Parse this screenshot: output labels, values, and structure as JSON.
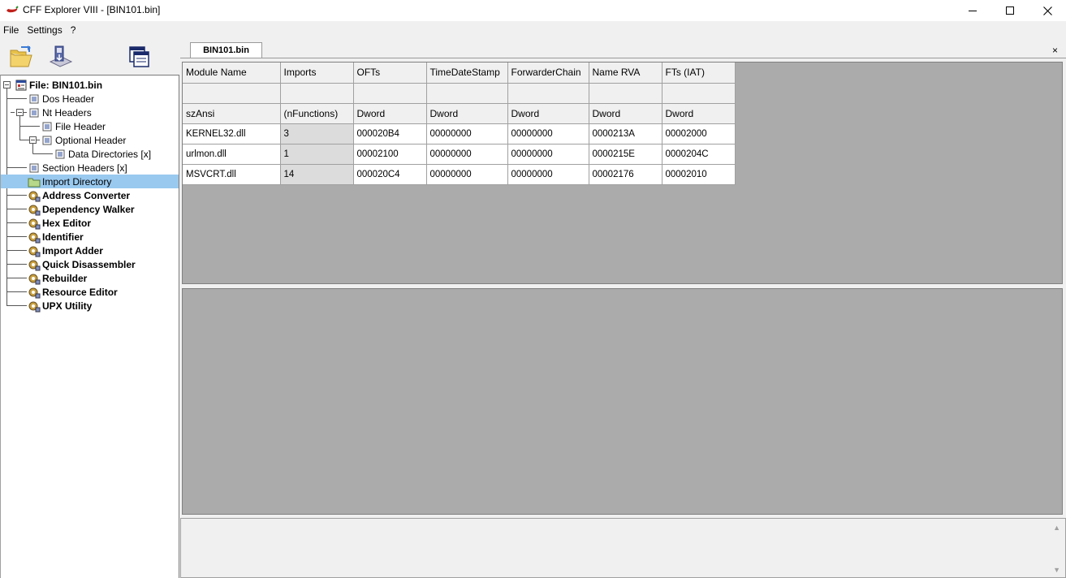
{
  "window": {
    "title": "CFF Explorer VIII - [BIN101.bin]"
  },
  "menu": {
    "items": [
      "File",
      "Settings",
      "?"
    ]
  },
  "toolbar": {
    "icons": [
      "open-file-icon",
      "save-disk-icon",
      "windows-icon"
    ]
  },
  "tree": {
    "items": [
      {
        "label": "File: BIN101.bin",
        "icon": "file-icon",
        "bold": true
      },
      {
        "label": "Dos Header",
        "icon": "list-icon"
      },
      {
        "label": "Nt Headers",
        "icon": "list-icon"
      },
      {
        "label": "File Header",
        "icon": "list-icon"
      },
      {
        "label": "Optional Header",
        "icon": "list-icon"
      },
      {
        "label": "Data Directories [x]",
        "icon": "list-icon"
      },
      {
        "label": "Section Headers [x]",
        "icon": "list-icon"
      },
      {
        "label": "Import Directory",
        "icon": "folder-icon",
        "selected": true
      },
      {
        "label": "Address Converter",
        "icon": "tool-icon",
        "bold": true
      },
      {
        "label": "Dependency Walker",
        "icon": "tool-icon",
        "bold": true
      },
      {
        "label": "Hex Editor",
        "icon": "tool-icon",
        "bold": true
      },
      {
        "label": "Identifier",
        "icon": "tool-icon",
        "bold": true
      },
      {
        "label": "Import Adder",
        "icon": "tool-icon",
        "bold": true
      },
      {
        "label": "Quick Disassembler",
        "icon": "tool-icon",
        "bold": true
      },
      {
        "label": "Rebuilder",
        "icon": "tool-icon",
        "bold": true
      },
      {
        "label": "Resource Editor",
        "icon": "tool-icon",
        "bold": true
      },
      {
        "label": "UPX Utility",
        "icon": "tool-icon",
        "bold": true
      }
    ]
  },
  "tab": {
    "label": "BIN101.bin",
    "close": "×"
  },
  "grid": {
    "columns": [
      "Module Name",
      "Imports",
      "OFTs",
      "TimeDateStamp",
      "ForwarderChain",
      "Name RVA",
      "FTs (IAT)"
    ],
    "types": [
      "szAnsi",
      "(nFunctions)",
      "Dword",
      "Dword",
      "Dword",
      "Dword",
      "Dword"
    ],
    "rows": [
      [
        "KERNEL32.dll",
        "3",
        "000020B4",
        "00000000",
        "00000000",
        "0000213A",
        "00002000"
      ],
      [
        "urlmon.dll",
        "1",
        "00002100",
        "00000000",
        "00000000",
        "0000215E",
        "0000204C"
      ],
      [
        "MSVCRT.dll",
        "14",
        "000020C4",
        "00000000",
        "00000000",
        "00002176",
        "00002010"
      ]
    ]
  },
  "colors": {
    "selection": "#99c9ef",
    "panel_gray": "#ababab",
    "imports_cell": "#dcdcdc"
  }
}
